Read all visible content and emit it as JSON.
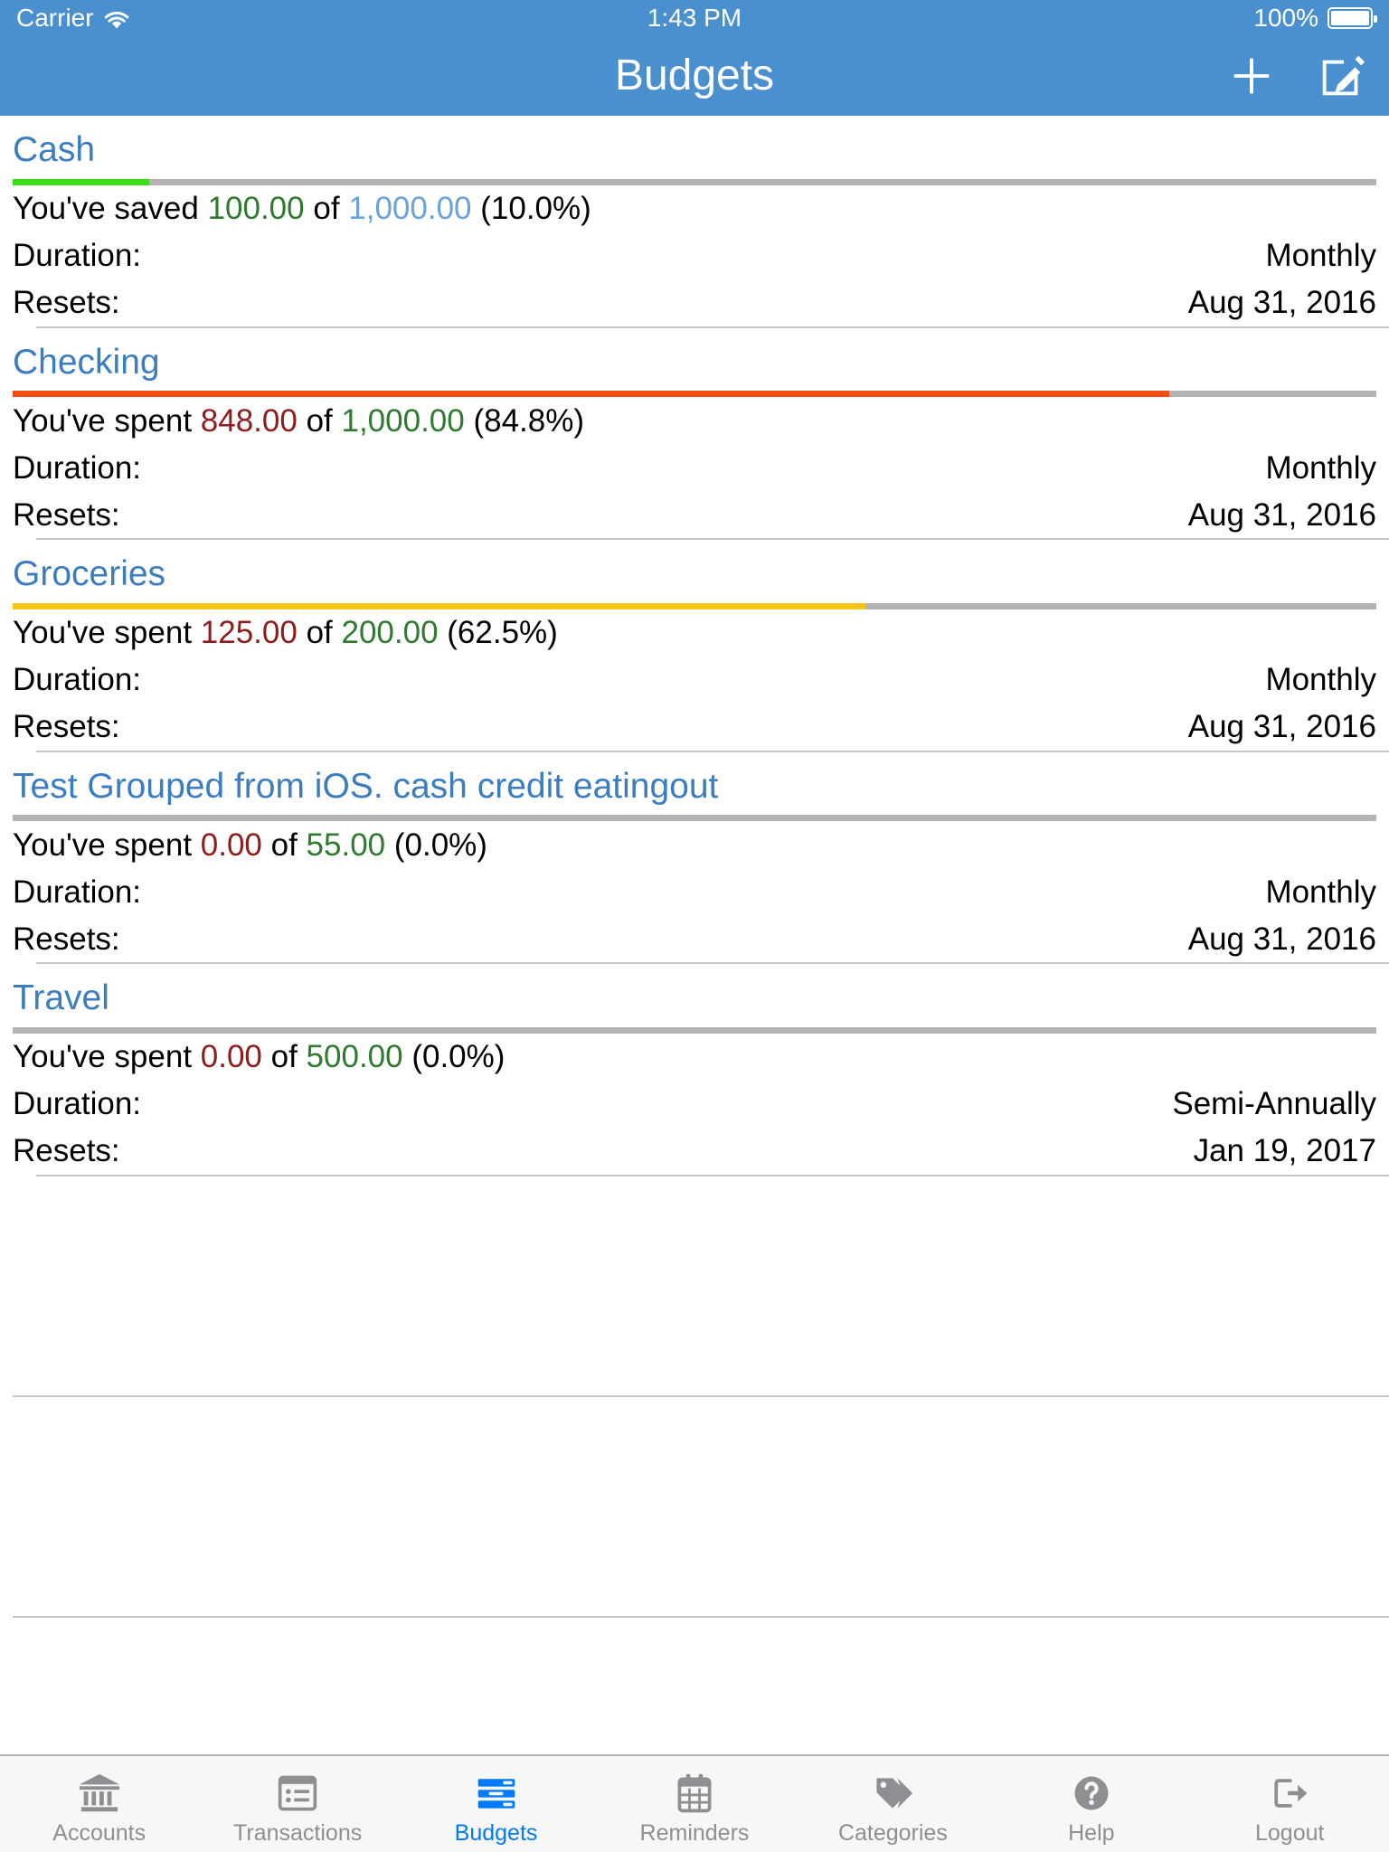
{
  "status_bar": {
    "carrier": "Carrier",
    "wifi_icon": "wifi-icon",
    "time": "1:43 PM",
    "battery_percent": "100%",
    "battery_icon": "battery-icon"
  },
  "navbar": {
    "title": "Budgets",
    "add_icon": "plus-icon",
    "add_label": "Add Budget",
    "edit_icon": "compose-icon",
    "edit_label": "Edit"
  },
  "labels": {
    "duration": "Duration:",
    "resets": "Resets:"
  },
  "colors": {
    "navbar": "#4a90ce",
    "title_blue": "#3b7dbf",
    "amount_blue": "#6aa3dc",
    "amount_green": "#2f7a2f",
    "amount_red": "#8f1c1c",
    "bar_green": "#3ddc18",
    "bar_orange": "#f04e12",
    "bar_yellow": "#f5c518",
    "bar_track": "#b3b3b3",
    "tab_active": "#007aff",
    "tab_inactive": "#8e8e93"
  },
  "budgets": [
    {
      "name": "Cash",
      "progress_percent": 10.0,
      "bar_color": "#3ddc18",
      "summary_prefix": "You've saved ",
      "current_amount": "100.00",
      "current_color": "#2f7a2f",
      "middle_text": " of ",
      "total_amount": "1,000.00",
      "total_color": "#6aa3dc",
      "percent_text": " (10.0%)",
      "duration": "Monthly",
      "resets": "Aug 31, 2016"
    },
    {
      "name": "Checking",
      "progress_percent": 84.8,
      "bar_color": "#f04e12",
      "summary_prefix": "You've spent ",
      "current_amount": "848.00",
      "current_color": "#8f1c1c",
      "middle_text": " of ",
      "total_amount": "1,000.00",
      "total_color": "#2f7a2f",
      "percent_text": " (84.8%)",
      "duration": "Monthly",
      "resets": "Aug 31, 2016"
    },
    {
      "name": "Groceries",
      "progress_percent": 62.5,
      "bar_color": "#f5c518",
      "summary_prefix": "You've spent ",
      "current_amount": "125.00",
      "current_color": "#8f1c1c",
      "middle_text": " of ",
      "total_amount": "200.00",
      "total_color": "#2f7a2f",
      "percent_text": " (62.5%)",
      "duration": "Monthly",
      "resets": "Aug 31, 2016"
    },
    {
      "name": "Test Grouped from iOS. cash credit eatingout",
      "progress_percent": 0.0,
      "bar_color": "#b3b3b3",
      "summary_prefix": "You've spent ",
      "current_amount": "0.00",
      "current_color": "#8f1c1c",
      "middle_text": " of ",
      "total_amount": "55.00",
      "total_color": "#2f7a2f",
      "percent_text": " (0.0%)",
      "duration": "Monthly",
      "resets": "Aug 31, 2016"
    },
    {
      "name": "Travel",
      "progress_percent": 0.0,
      "bar_color": "#b3b3b3",
      "summary_prefix": "You've spent ",
      "current_amount": "0.00",
      "current_color": "#8f1c1c",
      "middle_text": " of ",
      "total_amount": "500.00",
      "total_color": "#2f7a2f",
      "percent_text": " (0.0%)",
      "duration": "Semi-Annually",
      "resets": "Jan 19, 2017"
    }
  ],
  "empty_rows": 2,
  "tabbar": {
    "items": [
      {
        "label": "Accounts",
        "icon": "bank-icon",
        "active": false
      },
      {
        "label": "Transactions",
        "icon": "list-icon",
        "active": false
      },
      {
        "label": "Budgets",
        "icon": "budget-bars-icon",
        "active": true
      },
      {
        "label": "Reminders",
        "icon": "calendar-icon",
        "active": false
      },
      {
        "label": "Categories",
        "icon": "tags-icon",
        "active": false
      },
      {
        "label": "Help",
        "icon": "question-circle-icon",
        "active": false
      },
      {
        "label": "Logout",
        "icon": "logout-icon",
        "active": false
      }
    ]
  }
}
